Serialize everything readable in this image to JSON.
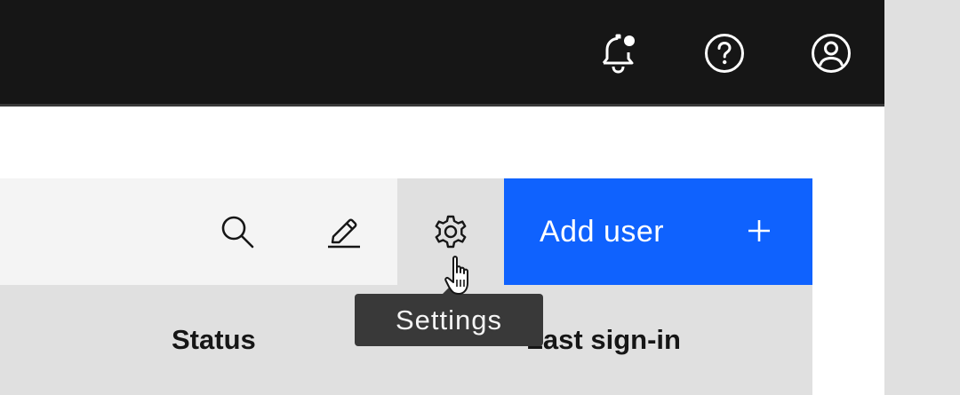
{
  "header": {
    "icons": [
      "notification-new-icon",
      "help-icon",
      "user-avatar-icon"
    ],
    "background": "#161616"
  },
  "toolbar": {
    "icons": [
      "search-icon",
      "edit-icon",
      "settings-icon"
    ],
    "add_user_label": "Add user",
    "add_user_icon": "add-icon",
    "accent": "#0f62fe"
  },
  "tooltip": {
    "text": "Settings"
  },
  "table": {
    "columns": [
      "Status",
      "Last sign-in"
    ]
  },
  "cursor": {
    "type": "pointer-hand"
  }
}
